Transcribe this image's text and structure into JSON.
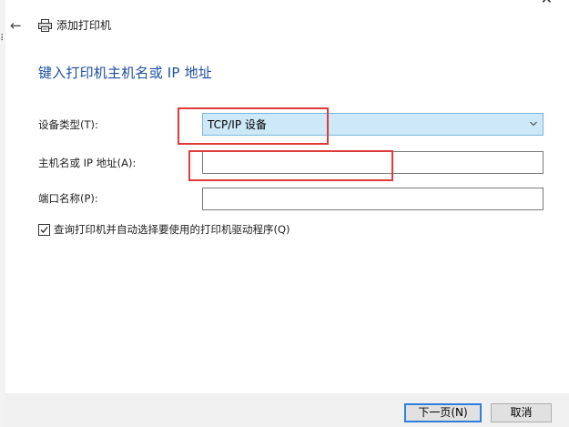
{
  "window": {
    "title": "添加打印机",
    "back_icon": "back-arrow-icon",
    "printer_icon": "printer-icon"
  },
  "heading": "键入打印机主机名或 IP 地址",
  "form": {
    "device_type_label": "设备类型(T):",
    "device_type_value": "TCP/IP 设备",
    "hostname_label": "主机名或 IP 地址(A):",
    "hostname_value": "",
    "port_name_label": "端口名称(P):",
    "port_name_value": "",
    "query_checkbox_label": "查询打印机并自动选择要使用的打印机驱动程序(Q)",
    "query_checkbox_checked": true
  },
  "buttons": {
    "next_label": "下一页(N)",
    "cancel_label": "取消"
  },
  "colors": {
    "heading": "#1c4fa0",
    "annotation": "#e03a3a",
    "select_bg": "#cde8f7",
    "focus_border": "#2f7ed8"
  }
}
